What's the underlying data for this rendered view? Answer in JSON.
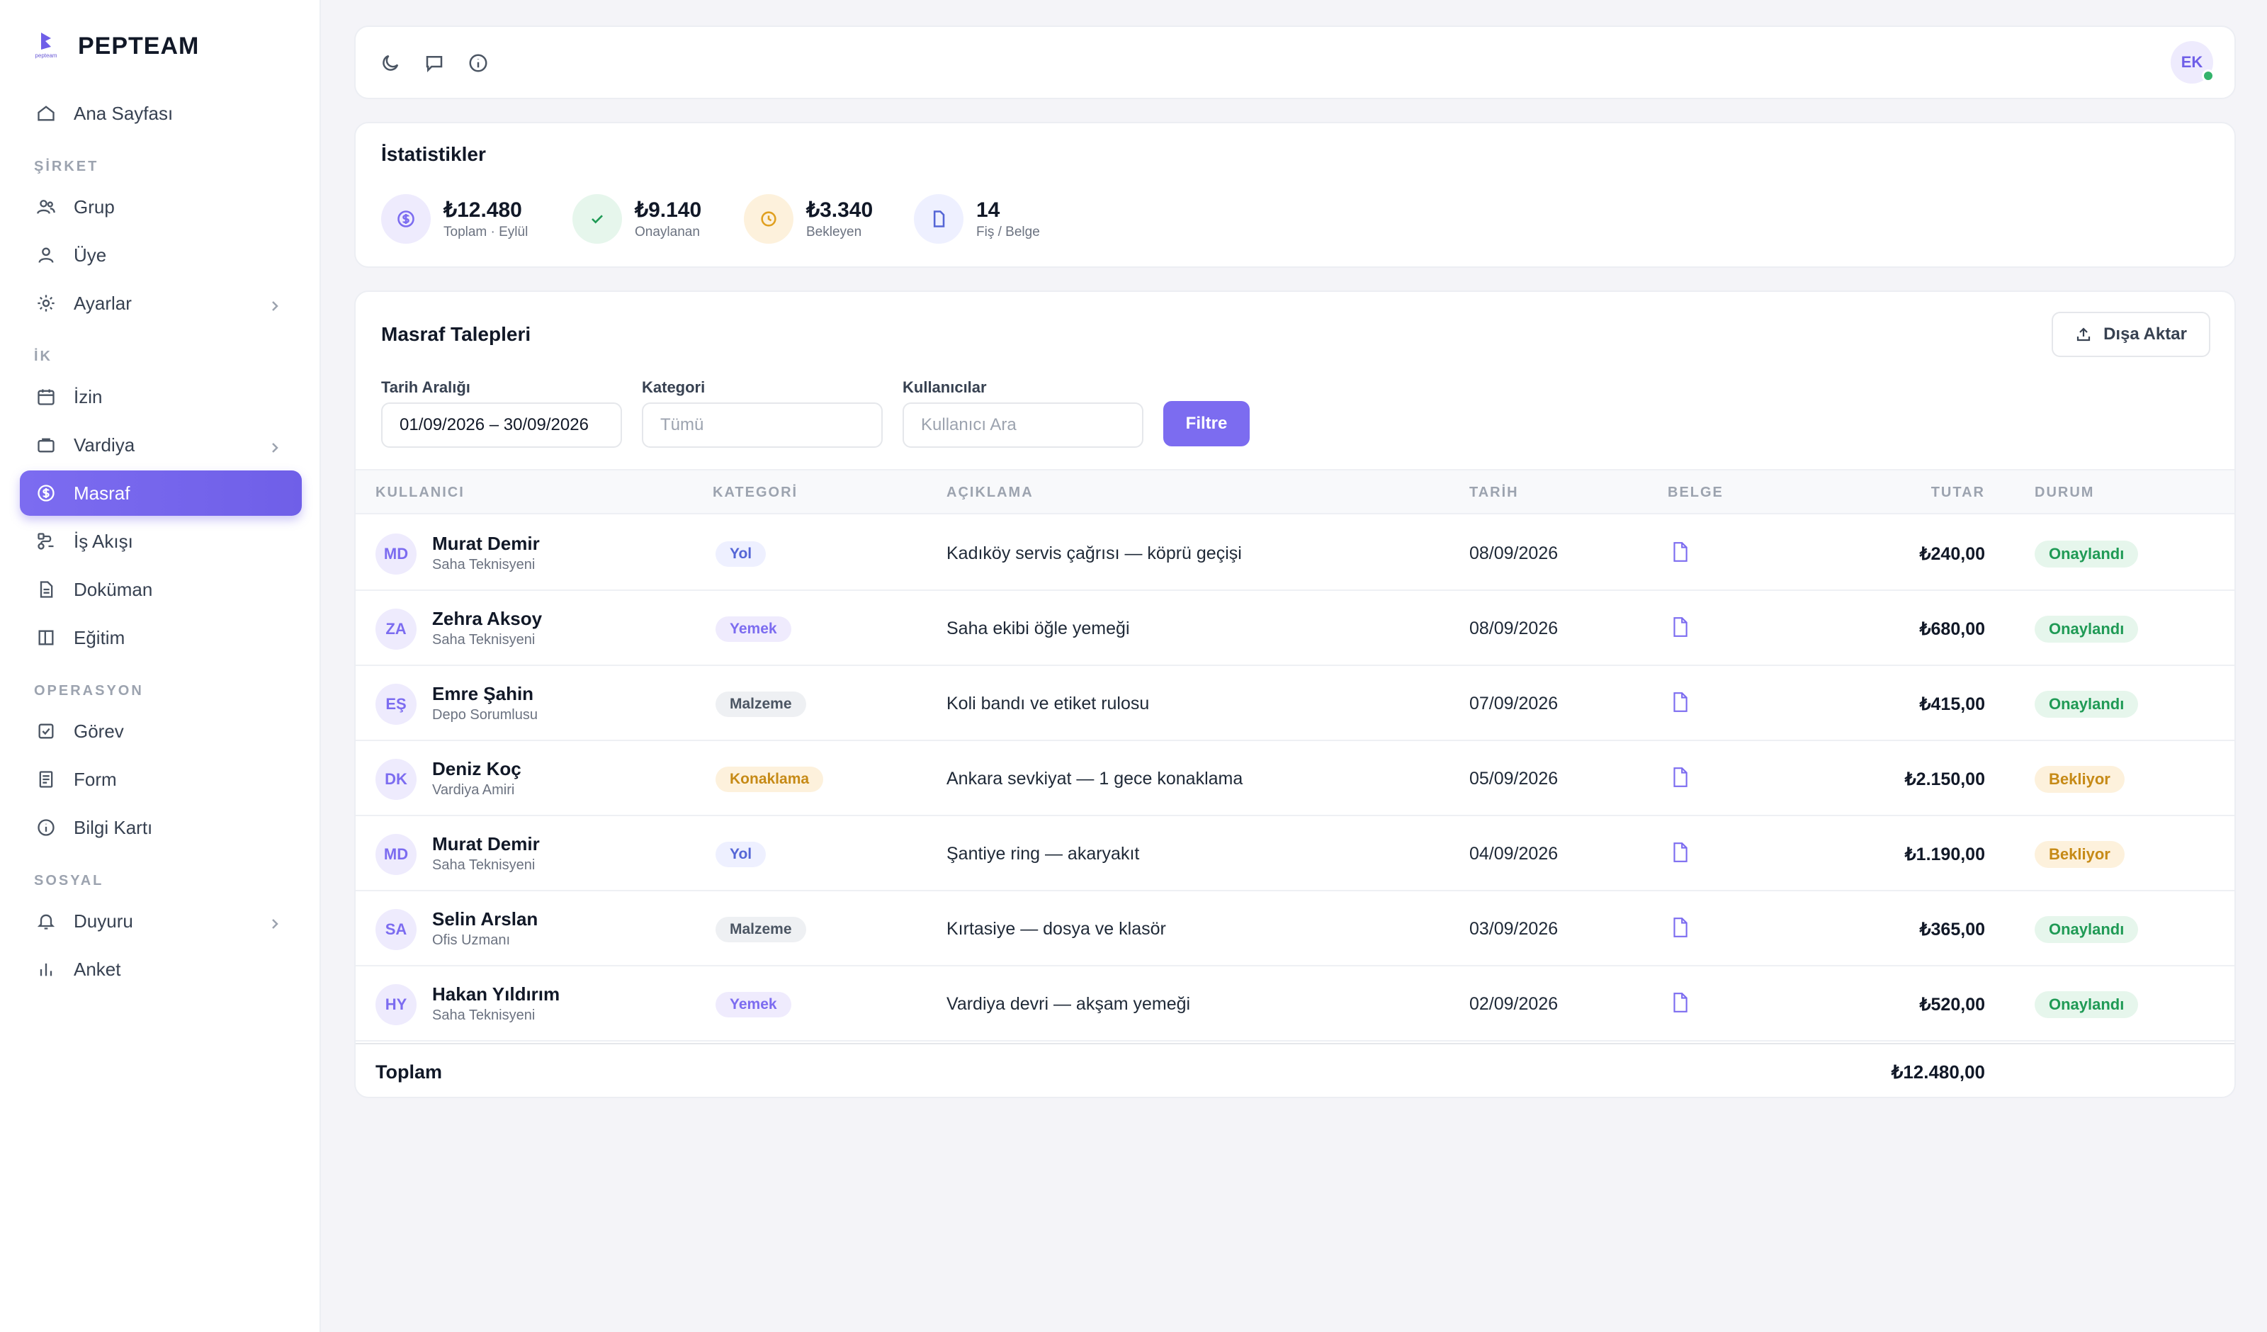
{
  "brand": {
    "name": "PEPTEAM",
    "logo_text": "pepteam"
  },
  "sidebar": {
    "home": "Ana Sayfası",
    "sections": {
      "company": "ŞİRKET",
      "hr": "İK",
      "operations": "OPERASYON",
      "social": "SOSYAL"
    },
    "items": {
      "group": "Grup",
      "member": "Üye",
      "settings": "Ayarlar",
      "leave": "İzin",
      "shift": "Vardiya",
      "expense": "Masraf",
      "workflow": "İş Akışı",
      "document": "Doküman",
      "training": "Eğitim",
      "task": "Görev",
      "form": "Form",
      "infocard": "Bilgi Kartı",
      "announcement": "Duyuru",
      "survey": "Anket"
    },
    "active": "expense"
  },
  "topbar": {
    "user_initials": "EK",
    "icons": [
      "moon-icon",
      "chat-icon",
      "info-icon"
    ]
  },
  "stats": {
    "title": "İstatistikler",
    "items": [
      {
        "value": "₺12.480",
        "label": "Toplam · Eylül"
      },
      {
        "value": "₺9.140",
        "label": "Onaylanan"
      },
      {
        "value": "₺3.340",
        "label": "Bekleyen"
      },
      {
        "value": "14",
        "label": "Fiş / Belge"
      }
    ]
  },
  "expenses": {
    "title": "Masraf Talepleri",
    "export_label": "Dışa Aktar",
    "filters": {
      "date_label": "Tarih Aralığı",
      "date_value": "01/09/2026 – 30/09/2026",
      "category_label": "Kategori",
      "category_placeholder": "Tümü",
      "users_label": "Kullanıcılar",
      "users_placeholder": "Kullanıcı Ara",
      "filter_button": "Filtre"
    },
    "columns": [
      "KULLANICI",
      "KATEGORİ",
      "AÇIKLAMA",
      "TARİH",
      "BELGE",
      "TUTAR",
      "DURUM"
    ],
    "rows": [
      {
        "initials": "MD",
        "name": "Murat Demir",
        "role": "Saha Teknisyeni",
        "category": "Yol",
        "description": "Kadıköy servis çağrısı — köprü geçişi",
        "date": "08/09/2026",
        "amount": "₺240,00",
        "status": "Onaylandı"
      },
      {
        "initials": "ZA",
        "name": "Zehra Aksoy",
        "role": "Saha Teknisyeni",
        "category": "Yemek",
        "description": "Saha ekibi öğle yemeği",
        "date": "08/09/2026",
        "amount": "₺680,00",
        "status": "Onaylandı"
      },
      {
        "initials": "EŞ",
        "name": "Emre Şahin",
        "role": "Depo Sorumlusu",
        "category": "Malzeme",
        "description": "Koli bandı ve etiket rulosu",
        "date": "07/09/2026",
        "amount": "₺415,00",
        "status": "Onaylandı"
      },
      {
        "initials": "DK",
        "name": "Deniz Koç",
        "role": "Vardiya Amiri",
        "category": "Konaklama",
        "description": "Ankara sevkiyat — 1 gece konaklama",
        "date": "05/09/2026",
        "amount": "₺2.150,00",
        "status": "Bekliyor"
      },
      {
        "initials": "MD",
        "name": "Murat Demir",
        "role": "Saha Teknisyeni",
        "category": "Yol",
        "description": "Şantiye ring — akaryakıt",
        "date": "04/09/2026",
        "amount": "₺1.190,00",
        "status": "Bekliyor"
      },
      {
        "initials": "SA",
        "name": "Selin Arslan",
        "role": "Ofis Uzmanı",
        "category": "Malzeme",
        "description": "Kırtasiye — dosya ve klasör",
        "date": "03/09/2026",
        "amount": "₺365,00",
        "status": "Onaylandı"
      },
      {
        "initials": "HY",
        "name": "Hakan Yıldırım",
        "role": "Saha Teknisyeni",
        "category": "Yemek",
        "description": "Vardiya devri — akşam yemeği",
        "date": "02/09/2026",
        "amount": "₺520,00",
        "status": "Onaylandı"
      }
    ],
    "total_label": "Toplam",
    "total_value": "₺12.480,00"
  },
  "colors": {
    "accent": "#7c6cf0",
    "approved": "#1f9a55",
    "pending": "#c68a16"
  }
}
